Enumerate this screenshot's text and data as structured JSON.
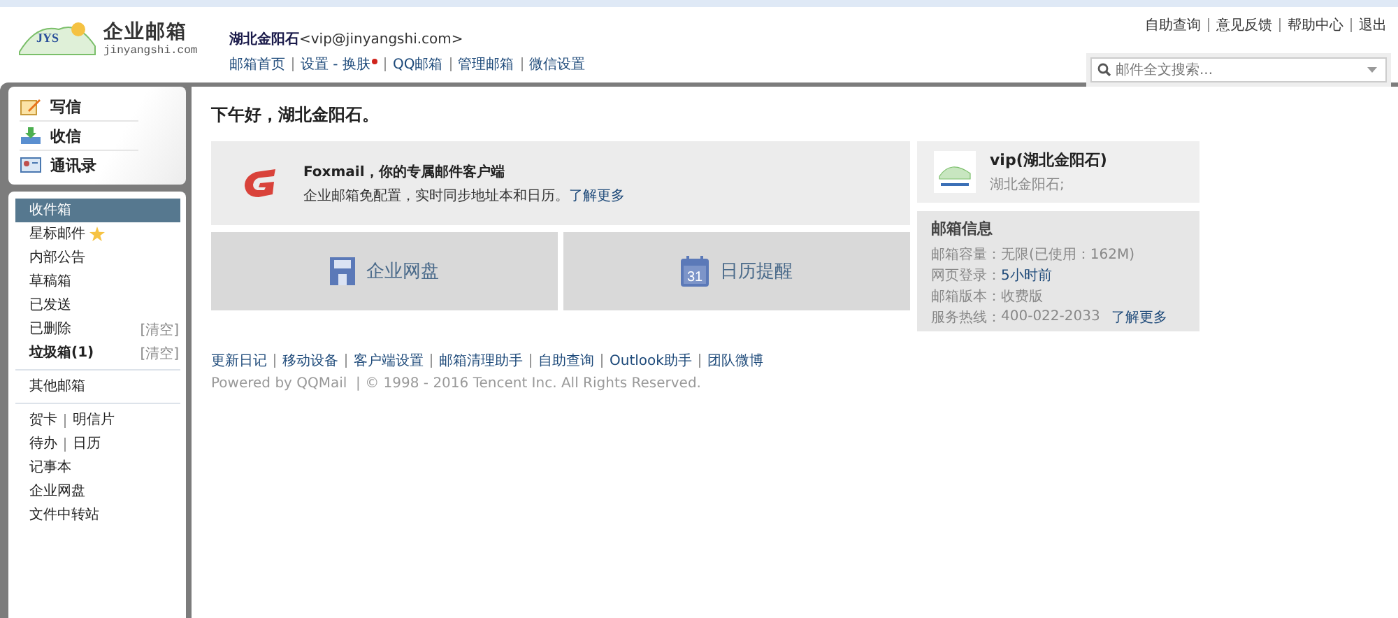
{
  "header": {
    "logo": {
      "badge": "JYS",
      "name": "企业邮箱",
      "domain": "jinyangshi.com"
    },
    "user_name": "湖北金阳石",
    "user_email": "<vip@jinyangshi.com>",
    "nav": [
      {
        "label": "邮箱首页",
        "dot": false
      },
      {
        "label": "设置 - 换肤",
        "dot": true
      },
      {
        "label": "QQ邮箱",
        "dot": false
      },
      {
        "label": "管理邮箱",
        "dot": false
      },
      {
        "label": "微信设置",
        "dot": false
      }
    ],
    "top_links": [
      "自助查询",
      "意见反馈",
      "帮助中心",
      "退出"
    ],
    "search": {
      "placeholder": "邮件全文搜索..."
    }
  },
  "quick_actions": [
    {
      "label": "写信",
      "kind": "compose"
    },
    {
      "label": "收信",
      "kind": "receive"
    },
    {
      "label": "通讯录",
      "kind": "contacts"
    }
  ],
  "folders": [
    {
      "label": "收件箱",
      "selected": true,
      "bold": false,
      "star": false
    },
    {
      "label": "星标邮件",
      "selected": false,
      "bold": false,
      "star": true
    },
    {
      "label": "内部公告",
      "selected": false,
      "bold": false,
      "star": false
    },
    {
      "label": "草稿箱",
      "selected": false,
      "bold": false,
      "star": false
    },
    {
      "label": "已发送",
      "selected": false,
      "bold": false,
      "star": false
    },
    {
      "label": "已删除",
      "selected": false,
      "bold": false,
      "star": false,
      "action": "[清空]"
    },
    {
      "label": "垃圾箱(1)",
      "selected": false,
      "bold": true,
      "star": false,
      "action": "[清空]"
    }
  ],
  "other_mailbox": "其他邮箱",
  "tools": [
    [
      "贺卡",
      "明信片"
    ],
    [
      "待办",
      "日历"
    ],
    [
      "记事本"
    ],
    [
      "企业网盘"
    ],
    [
      "文件中转站"
    ]
  ],
  "main": {
    "greeting": "下午好，湖北金阳石。",
    "promo": {
      "title": "Foxmail，你的专属邮件客户端",
      "text": "企业邮箱免配置，实时同步地址本和日历。",
      "link": "了解更多"
    },
    "tiles": [
      {
        "label": "企业网盘",
        "kind": "disk"
      },
      {
        "label": "日历提醒",
        "kind": "calendar",
        "day": "31"
      }
    ],
    "footer_links": [
      "更新日记",
      "移动设备",
      "客户端设置",
      "邮箱清理助手",
      "自助查询",
      "Outlook助手",
      "团队微博"
    ],
    "copyright": "Powered by QQMail  | © 1998 - 2016 Tencent Inc. All Rights Reserved."
  },
  "profile": {
    "name": "vip(湖北金阳石)",
    "signature": "湖北金阳石;"
  },
  "mailbox_info": {
    "title": "邮箱信息",
    "rows": [
      {
        "label": "邮箱容量：",
        "value": "无限(已使用：162M)",
        "link": false
      },
      {
        "label": "网页登录：",
        "value": "5小时前",
        "link": true
      },
      {
        "label": "邮箱版本：",
        "value": "收费版",
        "link": false
      },
      {
        "label": "服务热线：",
        "value": "400-022-2033",
        "link": false,
        "more": "了解更多"
      }
    ]
  }
}
